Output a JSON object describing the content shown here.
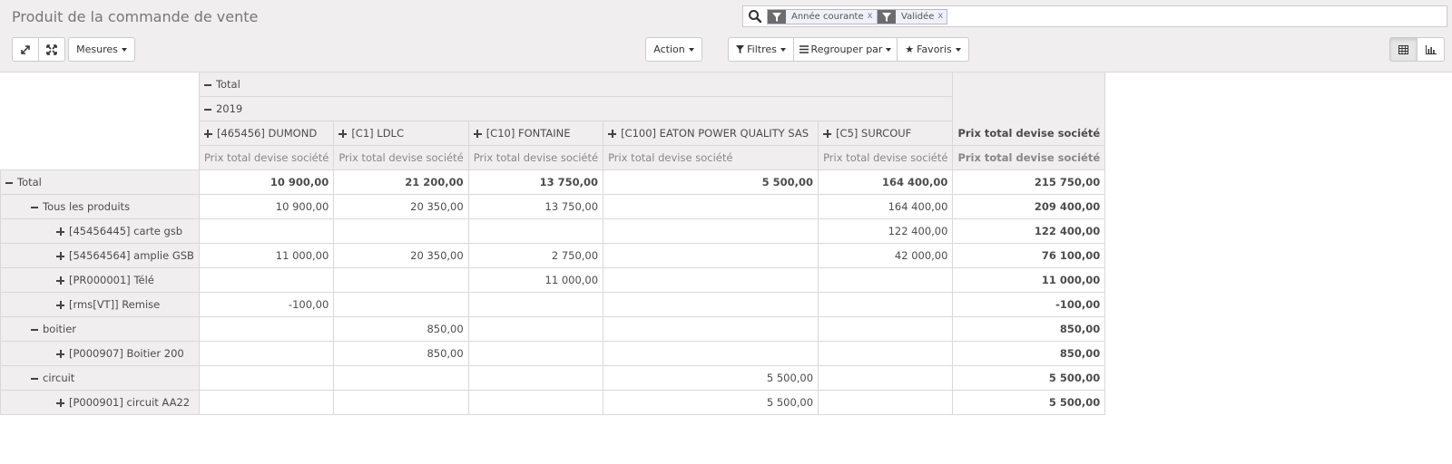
{
  "page": {
    "title": "Produit de la commande de vente"
  },
  "search": {
    "facets": [
      {
        "label": "Année courante",
        "remove": "x"
      },
      {
        "label": "Validée",
        "remove": "x"
      }
    ]
  },
  "toolbar": {
    "measures_label": "Mesures",
    "action_label": "Action",
    "filters_label": "Filtres",
    "groupby_label": "Regrouper par",
    "favorites_label": "Favoris"
  },
  "pivot": {
    "header": {
      "total": "Total",
      "year": "2019",
      "measure": "Prix total devise société",
      "total_measure": "Prix total devise société",
      "columns": [
        "[465456] DUMOND",
        "[C1] LDLC",
        "[C10] FONTAINE",
        "[C100] EATON POWER QUALITY SAS",
        "[C5] SURCOUF"
      ]
    },
    "rows": [
      {
        "label": "Total",
        "level": 0,
        "toggle": "minus",
        "bold": true,
        "values": [
          "10 900,00",
          "21 200,00",
          "13 750,00",
          "5 500,00",
          "164 400,00"
        ],
        "total": "215 750,00"
      },
      {
        "label": "Tous les produits",
        "level": 1,
        "toggle": "minus",
        "bold": false,
        "values": [
          "10 900,00",
          "20 350,00",
          "13 750,00",
          "",
          "164 400,00"
        ],
        "total": "209 400,00"
      },
      {
        "label": "[45456445] carte gsb",
        "level": 2,
        "toggle": "plus",
        "bold": false,
        "values": [
          "",
          "",
          "",
          "",
          "122 400,00"
        ],
        "total": "122 400,00"
      },
      {
        "label": "[54564564] amplie GSB",
        "level": 2,
        "toggle": "plus",
        "bold": false,
        "values": [
          "11 000,00",
          "20 350,00",
          "2 750,00",
          "",
          "42 000,00"
        ],
        "total": "76 100,00"
      },
      {
        "label": "[PR000001] Télé",
        "level": 2,
        "toggle": "plus",
        "bold": false,
        "values": [
          "",
          "",
          "11 000,00",
          "",
          ""
        ],
        "total": "11 000,00"
      },
      {
        "label": "[rms[VT]] Remise",
        "level": 2,
        "toggle": "plus",
        "bold": false,
        "values": [
          "-100,00",
          "",
          "",
          "",
          ""
        ],
        "total": "-100,00"
      },
      {
        "label": "boitier",
        "level": 1,
        "toggle": "minus",
        "bold": false,
        "values": [
          "",
          "850,00",
          "",
          "",
          ""
        ],
        "total": "850,00"
      },
      {
        "label": "[P000907] Boitier 200",
        "level": 2,
        "toggle": "plus",
        "bold": false,
        "values": [
          "",
          "850,00",
          "",
          "",
          ""
        ],
        "total": "850,00"
      },
      {
        "label": "circuit",
        "level": 1,
        "toggle": "minus",
        "bold": false,
        "values": [
          "",
          "",
          "",
          "5 500,00",
          ""
        ],
        "total": "5 500,00"
      },
      {
        "label": "[P000901] circuit AA22",
        "level": 2,
        "toggle": "plus",
        "bold": false,
        "values": [
          "",
          "",
          "",
          "5 500,00",
          ""
        ],
        "total": "5 500,00"
      }
    ]
  }
}
